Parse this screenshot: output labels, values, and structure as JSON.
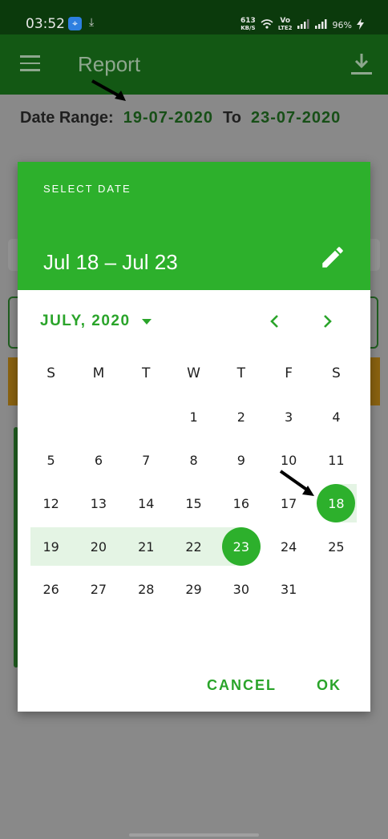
{
  "status": {
    "time": "03:52",
    "network_speed_top": "613",
    "network_speed_unit": "KB/S",
    "lte_label_top": "Vo",
    "lte_label_bottom": "LTE2",
    "battery": "96%"
  },
  "appbar": {
    "title": "Report"
  },
  "date_range": {
    "label": "Date Range:",
    "from": "19-07-2020",
    "to_label": "To",
    "to": "23-07-2020"
  },
  "dialog": {
    "header_label": "SELECT DATE",
    "range_text": "Jul 18 – Jul 23",
    "month_label": "JULY, 2020",
    "weekdays": [
      "S",
      "M",
      "T",
      "W",
      "T",
      "F",
      "S"
    ],
    "weeks": [
      [
        "",
        "",
        "",
        "1",
        "2",
        "3",
        "4"
      ],
      [
        "5",
        "6",
        "7",
        "8",
        "9",
        "10",
        "11"
      ],
      [
        "12",
        "13",
        "14",
        "15",
        "16",
        "17",
        "18"
      ],
      [
        "19",
        "20",
        "21",
        "22",
        "23",
        "24",
        "25"
      ],
      [
        "26",
        "27",
        "28",
        "29",
        "30",
        "31",
        ""
      ]
    ],
    "selected_start": "18",
    "selected_end": "23",
    "cancel_label": "CANCEL",
    "ok_label": "OK"
  },
  "colors": {
    "accent": "#2db02c",
    "range_fill": "#e4f4e4",
    "appbar_dim": "#135814"
  }
}
